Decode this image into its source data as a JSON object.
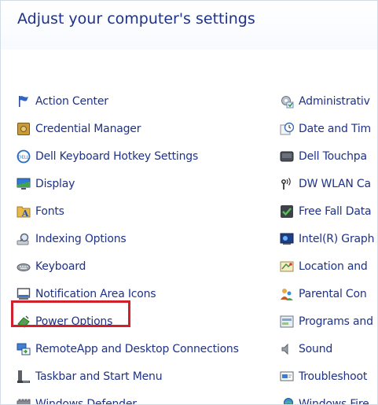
{
  "header": {
    "title": "Adjust your computer's settings"
  },
  "left_items": [
    {
      "label": "Action Center",
      "icon": "flag-icon"
    },
    {
      "label": "Credential Manager",
      "icon": "vault-icon"
    },
    {
      "label": "Dell Keyboard Hotkey Settings",
      "icon": "dell-logo-icon"
    },
    {
      "label": "Display",
      "icon": "monitor-icon"
    },
    {
      "label": "Fonts",
      "icon": "fonts-folder-icon"
    },
    {
      "label": "Indexing Options",
      "icon": "magnifier-icon"
    },
    {
      "label": "Keyboard",
      "icon": "keyboard-icon"
    },
    {
      "label": "Notification Area Icons",
      "icon": "taskbar-monitor-icon"
    },
    {
      "label": "Power Options",
      "icon": "power-options-icon"
    },
    {
      "label": "RemoteApp and Desktop Connections",
      "icon": "remote-desktop-icon"
    },
    {
      "label": "Taskbar and Start Menu",
      "icon": "taskbar-icon"
    },
    {
      "label": "Windows Defender",
      "icon": "castle-wall-icon"
    }
  ],
  "right_items": [
    {
      "label": "Administrativ",
      "icon": "admin-tools-icon"
    },
    {
      "label": "Date and Tim",
      "icon": "clock-icon"
    },
    {
      "label": "Dell Touchpa",
      "icon": "touchpad-icon"
    },
    {
      "label": "DW WLAN Ca",
      "icon": "wlan-antenna-icon"
    },
    {
      "label": "Free Fall Data",
      "icon": "check-shield-icon"
    },
    {
      "label": "Intel(R) Graph",
      "icon": "intel-graphics-icon"
    },
    {
      "label": "Location and",
      "icon": "location-icon"
    },
    {
      "label": "Parental Con",
      "icon": "parental-controls-icon"
    },
    {
      "label": "Programs and",
      "icon": "programs-icon"
    },
    {
      "label": "Sound",
      "icon": "speaker-icon"
    },
    {
      "label": "Troubleshoot",
      "icon": "troubleshoot-icon"
    },
    {
      "label": "Windows Fire",
      "icon": "firewall-icon"
    }
  ],
  "highlighted_item": "Power Options",
  "colors": {
    "link": "#1e3287",
    "highlight_border": "#d0202c"
  }
}
